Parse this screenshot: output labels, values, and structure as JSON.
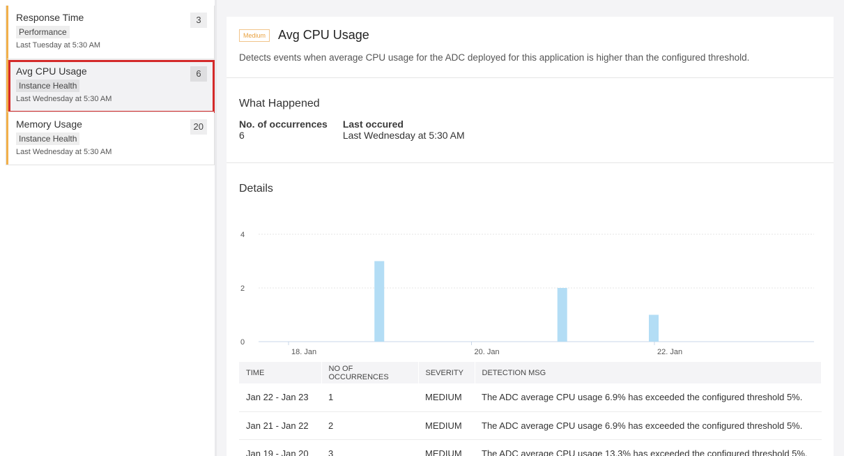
{
  "alerts": [
    {
      "title": "Response Time",
      "tag": "Performance",
      "time": "Last Tuesday at 5:30 AM",
      "count": "3"
    },
    {
      "title": "Avg CPU Usage",
      "tag": "Instance Health",
      "time": "Last Wednesday at 5:30 AM",
      "count": "6"
    },
    {
      "title": "Memory Usage",
      "tag": "Instance Health",
      "time": "Last Wednesday at 5:30 AM",
      "count": "20"
    }
  ],
  "detail": {
    "severity": "Medium",
    "title": "Avg CPU Usage",
    "description": "Detects events when average CPU usage for the ADC deployed for this application is higher than the configured threshold.",
    "what_happened": {
      "title": "What Happened",
      "occurrences_label": "No. of occurrences",
      "occurrences_value": "6",
      "last_label": "Last occured",
      "last_value": "Last Wednesday at 5:30 AM"
    },
    "details_title": "Details"
  },
  "chart_data": {
    "type": "bar",
    "x_ticks": [
      "18. Jan",
      "20. Jan",
      "22. Jan"
    ],
    "y_ticks": [
      "0",
      "2",
      "4"
    ],
    "ylim": [
      0,
      4
    ],
    "points": [
      {
        "x": "2019-01-19",
        "value": 3
      },
      {
        "x": "2019-01-21",
        "value": 2
      },
      {
        "x": "2019-01-22",
        "value": 1
      }
    ],
    "bar_color": "#b3ddf5",
    "grid": true
  },
  "table": {
    "headers": [
      "TIME",
      "NO OF OCCURRENCES",
      "SEVERITY",
      "DETECTION MSG"
    ],
    "rows": [
      [
        "Jan 22 - Jan 23",
        "1",
        "MEDIUM",
        "The ADC average CPU usage 6.9% has exceeded the configured threshold 5%."
      ],
      [
        "Jan 21 - Jan 22",
        "2",
        "MEDIUM",
        "The ADC average CPU usage 6.9% has exceeded the configured threshold 5%."
      ],
      [
        "Jan 19 - Jan 20",
        "3",
        "MEDIUM",
        "The ADC average CPU usage 13.3% has exceeded the configured threshold 5%."
      ]
    ]
  },
  "colors": {
    "accent": "#f2b04a",
    "selection": "#d42a2a",
    "bar": "#b3ddf5"
  }
}
